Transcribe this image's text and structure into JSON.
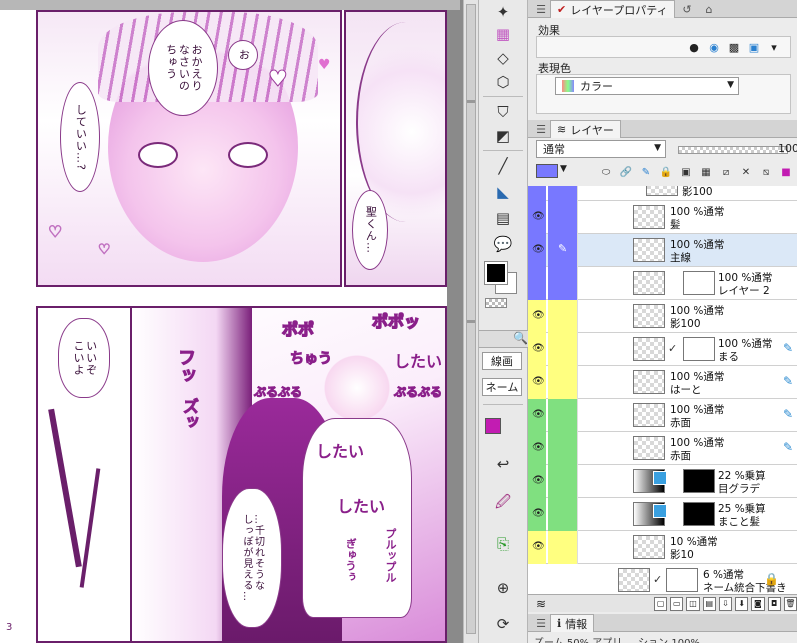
{
  "canvas": {
    "page_number": "3",
    "bubbles": {
      "o": "お",
      "okaeri": "おかえり\nなさいの\nちゅう",
      "shiteiii": "していい…?",
      "hijirikun": "聖くん…",
      "iizo": "いいぞ\nこいよ",
      "chigire": "…千切れそうな\nしっぽが見える…"
    },
    "sfx": {
      "popo1": "ポポ",
      "popo2": "ポポッ",
      "chuu": "ちゅう",
      "shitai1": "したい",
      "shitai2": "したい",
      "shitai3": "したい",
      "buruburu1": "ぷるぷる",
      "buruburu2": "ぷるぷる",
      "futt": "フッ",
      "zuu": "ズッ",
      "gyuu": "ぎゅうぅ",
      "puruppuru": "プルップル"
    }
  },
  "tools": {
    "mode_label": "線画",
    "name_label": "ネーム",
    "fg_color": "#000000",
    "bg_color": "#ffffff",
    "accent_color": "#c21cb2"
  },
  "layer_property": {
    "tab_label": "レイヤープロパティ",
    "effect_label": "効果",
    "display_color_label": "表現色",
    "display_color_value": "カラー"
  },
  "layer_panel": {
    "tab_label": "レイヤー",
    "blend_mode": "通常",
    "opacity_value": "100",
    "layers": [
      {
        "line1": "",
        "line2": "影100",
        "color": "#fff",
        "partial": true
      },
      {
        "line1": "100 %通常",
        "line2": "髪",
        "color": "#fff"
      },
      {
        "line1": "100 %通常",
        "line2": "主線",
        "color": "#fff",
        "selected": true
      },
      {
        "line1": "100 %通常",
        "line2": "レイヤー 2",
        "color": "#fff"
      },
      {
        "line1": "100 %通常",
        "line2": "影100",
        "color": "#ffff80"
      },
      {
        "line1": "100 %通常",
        "line2": "まる",
        "color": "#ffff80"
      },
      {
        "line1": "100 %通常",
        "line2": "はーと",
        "color": "#ffff80"
      },
      {
        "line1": "100 %通常",
        "line2": "赤面",
        "color": "#80e080"
      },
      {
        "line1": "100 %通常",
        "line2": "赤面",
        "color": "#80e080"
      },
      {
        "line1": "22 %乗算",
        "line2": "目グラデ",
        "color": "#80e080"
      },
      {
        "line1": "25 %乗算",
        "line2": "まこと髪",
        "color": "#80e080"
      },
      {
        "line1": "10 %通常",
        "line2": "影10",
        "color": "#ffff80"
      },
      {
        "line1": "6 %通常",
        "line2": "ネーム統合下書き",
        "color": "#fff"
      }
    ]
  },
  "info_panel": {
    "tab_label": "情報",
    "status_text": "ズーム 50% アプリ ... ション 100%"
  }
}
